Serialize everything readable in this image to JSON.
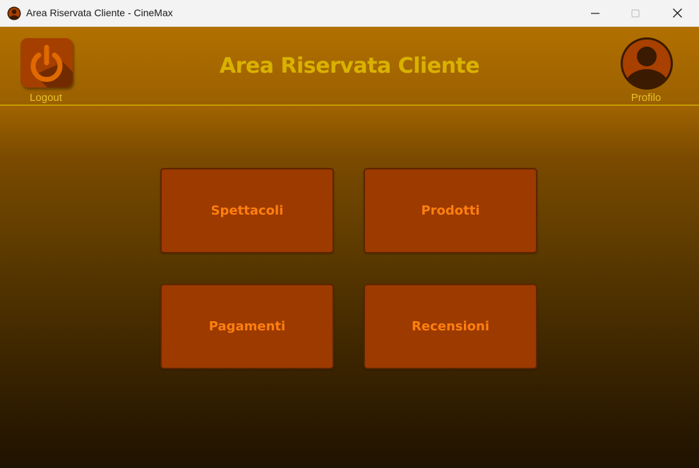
{
  "window": {
    "title": "Area Riservata Cliente - CineMax",
    "app_icon": "user-avatar-icon",
    "controls": [
      "minimize-icon",
      "maximize-icon",
      "close-icon"
    ]
  },
  "header": {
    "title": "Area Riservata Cliente",
    "logout": {
      "label": "Logout",
      "icon": "power-icon"
    },
    "profile": {
      "label": "Profilo",
      "icon": "user-avatar-icon"
    }
  },
  "menu": {
    "items": [
      {
        "label": "Spettacoli"
      },
      {
        "label": "Prodotti"
      },
      {
        "label": "Pagamenti"
      },
      {
        "label": "Recensioni"
      }
    ]
  },
  "colors": {
    "header_bg": "#b27000",
    "title_text": "#d9b200",
    "tile_bg": "#9c3a00",
    "tile_text": "#ff7f0e",
    "label_text": "#e8c02a"
  }
}
